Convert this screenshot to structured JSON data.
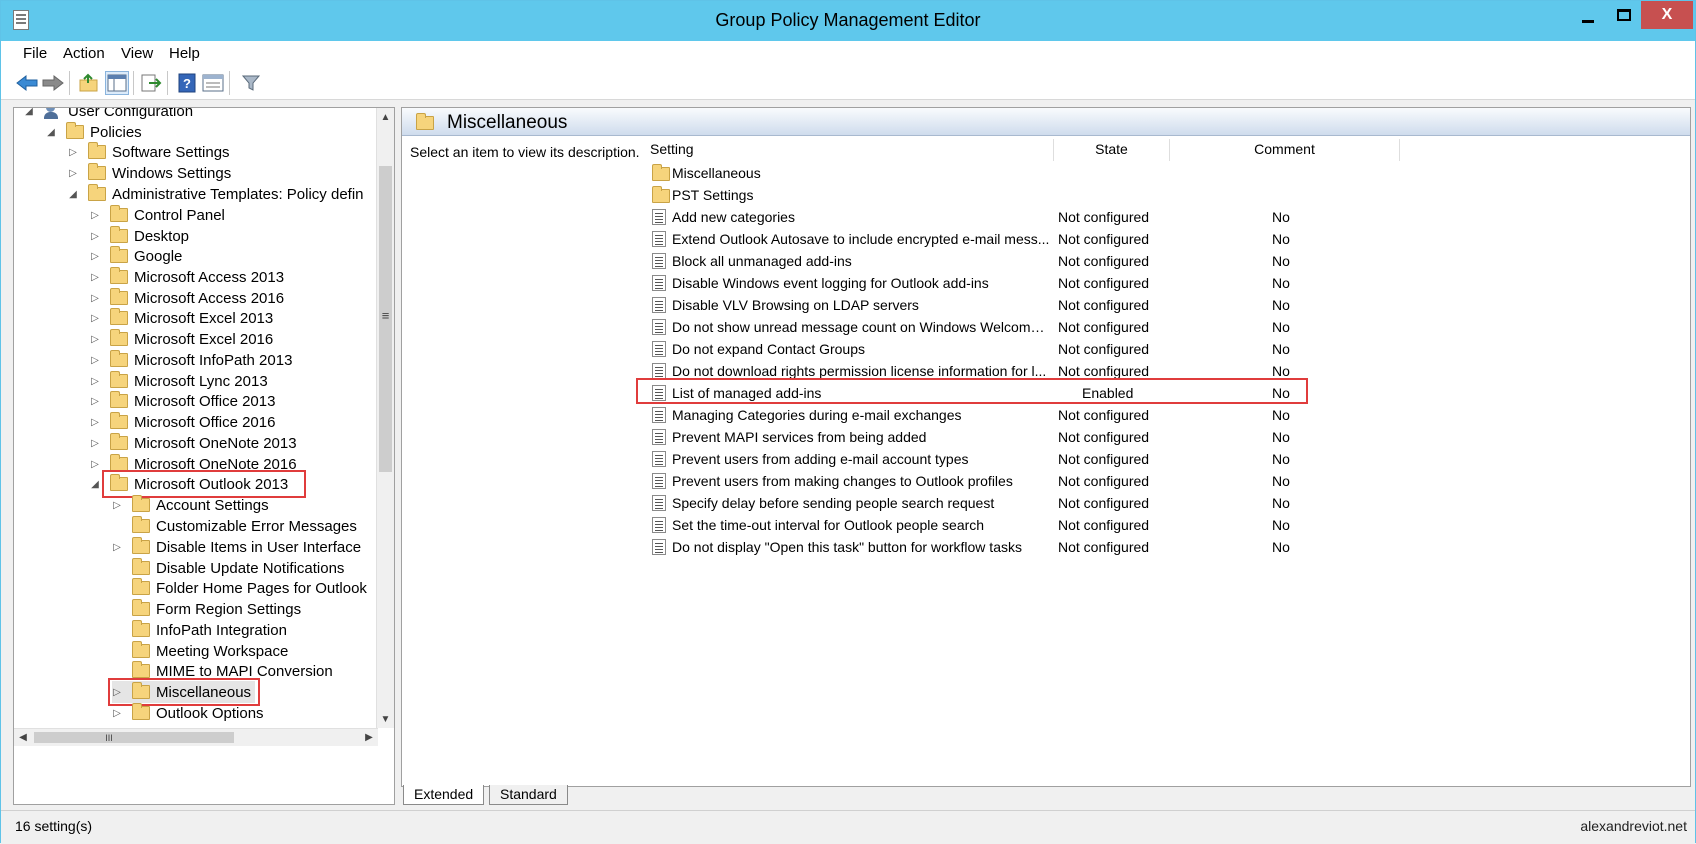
{
  "window": {
    "title": "Group Policy Management Editor",
    "close_label": "X"
  },
  "menu": [
    "File",
    "Action",
    "View",
    "Help"
  ],
  "toolbar_icons": [
    "back-arrow-icon",
    "forward-arrow-icon",
    "up-folder-icon",
    "show-hide-tree-icon",
    "export-list-icon",
    "help-icon",
    "properties-icon",
    "filter-icon"
  ],
  "tree": {
    "items": [
      {
        "label": "User Configuration",
        "expander": "◢",
        "icon": "user-config-icon"
      },
      {
        "label": "Policies",
        "expander": "◢"
      },
      {
        "label": "Software Settings",
        "expander": "▷"
      },
      {
        "label": "Windows Settings",
        "expander": "▷"
      },
      {
        "label": "Administrative Templates: Policy defin",
        "expander": "◢"
      },
      {
        "label": "Control Panel",
        "expander": "▷"
      },
      {
        "label": "Desktop",
        "expander": "▷"
      },
      {
        "label": "Google",
        "expander": "▷"
      },
      {
        "label": "Microsoft Access 2013",
        "expander": "▷"
      },
      {
        "label": "Microsoft Access 2016",
        "expander": "▷"
      },
      {
        "label": "Microsoft Excel 2013",
        "expander": "▷"
      },
      {
        "label": "Microsoft Excel 2016",
        "expander": "▷"
      },
      {
        "label": "Microsoft InfoPath 2013",
        "expander": "▷"
      },
      {
        "label": "Microsoft Lync 2013",
        "expander": "▷"
      },
      {
        "label": "Microsoft Office 2013",
        "expander": "▷"
      },
      {
        "label": "Microsoft Office 2016",
        "expander": "▷"
      },
      {
        "label": "Microsoft OneNote 2013",
        "expander": "▷"
      },
      {
        "label": "Microsoft OneNote 2016",
        "expander": "▷"
      },
      {
        "label": "Microsoft Outlook 2013",
        "expander": "◢"
      },
      {
        "label": "Account Settings",
        "expander": "▷"
      },
      {
        "label": "Customizable Error Messages",
        "expander": ""
      },
      {
        "label": "Disable Items in User Interface",
        "expander": "▷"
      },
      {
        "label": "Disable Update Notifications",
        "expander": ""
      },
      {
        "label": "Folder Home Pages for Outlook",
        "expander": ""
      },
      {
        "label": "Form Region Settings",
        "expander": ""
      },
      {
        "label": "InfoPath Integration",
        "expander": ""
      },
      {
        "label": "Meeting Workspace",
        "expander": ""
      },
      {
        "label": "MIME to MAPI Conversion",
        "expander": ""
      },
      {
        "label": "Miscellaneous",
        "expander": "▷"
      },
      {
        "label": "Outlook Options",
        "expander": "▷"
      }
    ],
    "scroll_labels": {
      "up": "▲",
      "down": "▼",
      "left": "◀",
      "right": "▶",
      "grip": "≡",
      "hgrip": "III"
    }
  },
  "details": {
    "header_title": "Miscellaneous",
    "description": "Select an item to view its description.",
    "columns": {
      "setting": "Setting",
      "state": "State",
      "comment": "Comment"
    },
    "rows": [
      {
        "type": "folder",
        "setting": "Miscellaneous",
        "state": "",
        "comment": ""
      },
      {
        "type": "folder",
        "setting": "PST Settings",
        "state": "",
        "comment": ""
      },
      {
        "type": "policy",
        "setting": "Add new categories",
        "state": "Not configured",
        "comment": "No"
      },
      {
        "type": "policy",
        "setting": "Extend Outlook Autosave to include encrypted e-mail mess...",
        "state": "Not configured",
        "comment": "No"
      },
      {
        "type": "policy",
        "setting": "Block all unmanaged add-ins",
        "state": "Not configured",
        "comment": "No"
      },
      {
        "type": "policy",
        "setting": "Disable Windows event logging for Outlook add-ins",
        "state": "Not configured",
        "comment": "No"
      },
      {
        "type": "policy",
        "setting": "Disable VLV Browsing on LDAP servers",
        "state": "Not configured",
        "comment": "No"
      },
      {
        "type": "policy",
        "setting": "Do not show unread message count on Windows Welcome ...",
        "state": "Not configured",
        "comment": "No"
      },
      {
        "type": "policy",
        "setting": "Do not expand Contact Groups",
        "state": "Not configured",
        "comment": "No"
      },
      {
        "type": "policy",
        "setting": "Do not download rights permission license information for l...",
        "state": "Not configured",
        "comment": "No"
      },
      {
        "type": "policy",
        "setting": "List of managed add-ins",
        "state": "Enabled",
        "comment": "No"
      },
      {
        "type": "policy",
        "setting": "Managing Categories during e-mail exchanges",
        "state": "Not configured",
        "comment": "No"
      },
      {
        "type": "policy",
        "setting": "Prevent MAPI services from being added",
        "state": "Not configured",
        "comment": "No"
      },
      {
        "type": "policy",
        "setting": "Prevent users from adding e-mail account types",
        "state": "Not configured",
        "comment": "No"
      },
      {
        "type": "policy",
        "setting": "Prevent users from making changes to Outlook profiles",
        "state": "Not configured",
        "comment": "No"
      },
      {
        "type": "policy",
        "setting": "Specify delay before sending people search request",
        "state": "Not configured",
        "comment": "No"
      },
      {
        "type": "policy",
        "setting": "Set the time-out interval for Outlook people search",
        "state": "Not configured",
        "comment": "No"
      },
      {
        "type": "policy",
        "setting": "Do not display \"Open this task\" button for workflow tasks",
        "state": "Not configured",
        "comment": "No"
      }
    ]
  },
  "tabs": {
    "extended": "Extended",
    "standard": "Standard"
  },
  "status": {
    "text": "16 setting(s)",
    "watermark": "alexandreviot.net"
  },
  "colors": {
    "highlight": "#e03c3c",
    "titlebar": "#5fc8ec"
  }
}
